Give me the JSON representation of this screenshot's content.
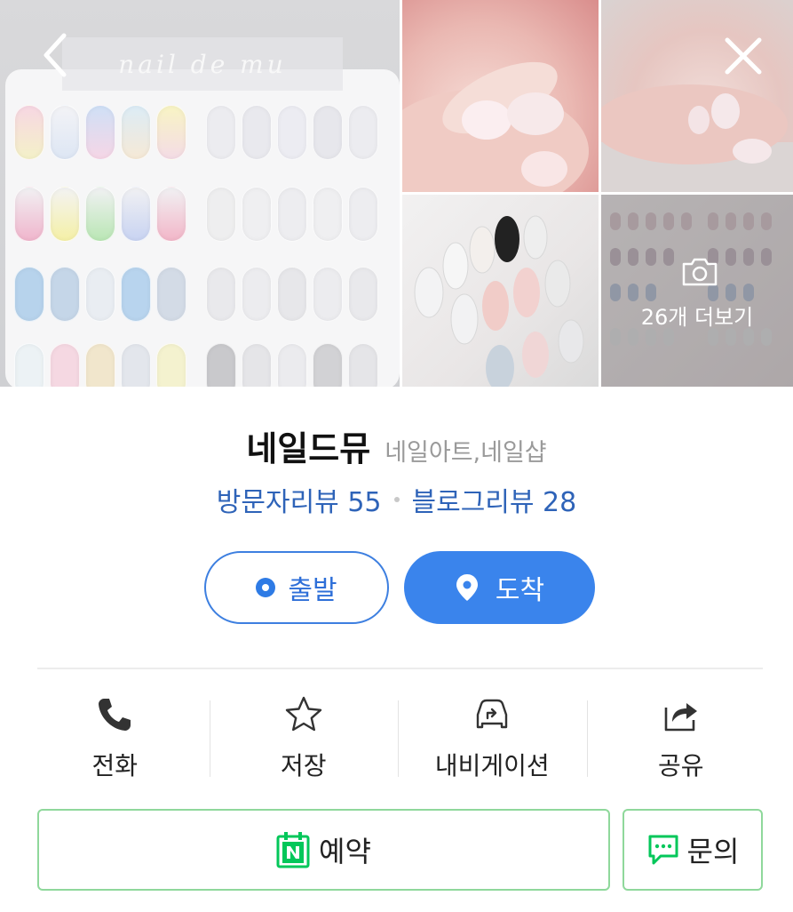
{
  "gallery": {
    "watermark": "nail de mu",
    "more_label": "26개 더보기"
  },
  "place": {
    "name": "네일드뮤",
    "category": "네일아트,네일샵",
    "visitor_reviews": "방문자리뷰 55",
    "blog_reviews": "블로그리뷰 28"
  },
  "route": {
    "depart_label": "출발",
    "arrive_label": "도착"
  },
  "actions": [
    {
      "label": "전화",
      "icon": "phone-icon"
    },
    {
      "label": "저장",
      "icon": "star-icon"
    },
    {
      "label": "내비게이션",
      "icon": "navigation-car-icon"
    },
    {
      "label": "공유",
      "icon": "share-icon"
    }
  ],
  "bottom": {
    "reserve_label": "예약",
    "inquiry_label": "문의"
  },
  "colors": {
    "link_blue": "#2e63b8",
    "primary_blue": "#3a84ec",
    "naver_green": "#03c75a",
    "border_green": "#8fd89b"
  }
}
